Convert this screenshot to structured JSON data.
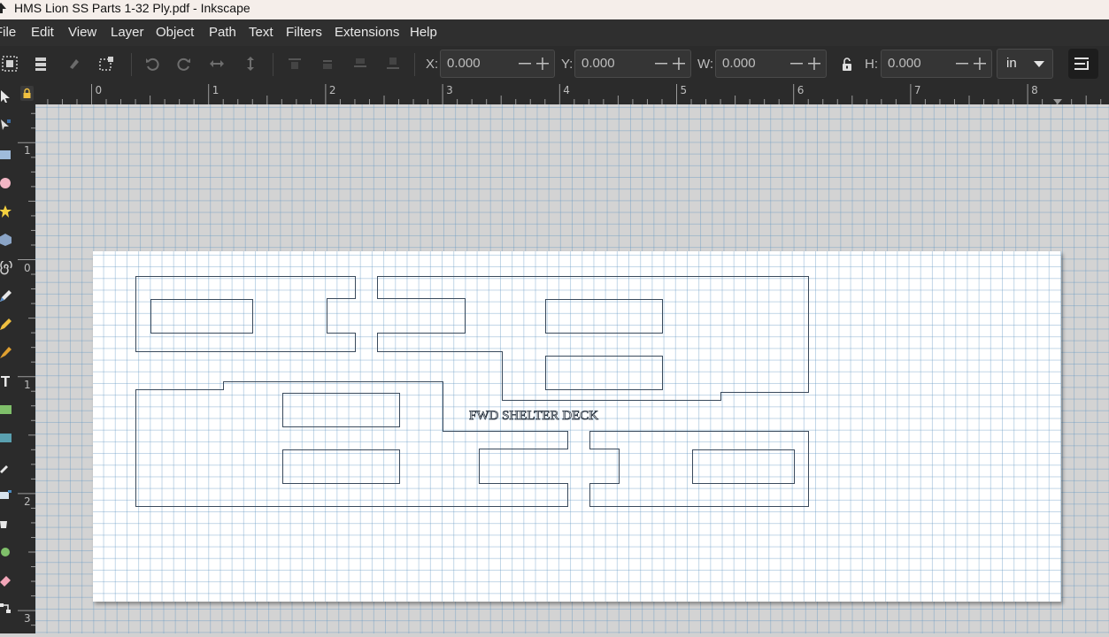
{
  "window": {
    "title": "HMS Lion SS Parts 1-32 Ply.pdf - Inkscape"
  },
  "menu": {
    "items": [
      "File",
      "Edit",
      "View",
      "Layer",
      "Object",
      "Path",
      "Text",
      "Filters",
      "Extensions",
      "Help"
    ]
  },
  "toolbar": {
    "x_label": "X:",
    "x_value": "0.000",
    "y_label": "Y:",
    "y_value": "0.000",
    "w_label": "W:",
    "w_value": "0.000",
    "h_label": "H:",
    "h_value": "0.000",
    "unit": "in",
    "icons": [
      "select-all-icon",
      "select-all-layers-icon",
      "deselect-icon",
      "select-same-icon",
      "rotate-ccw-icon",
      "rotate-cw-icon",
      "flip-horizontal-icon",
      "flip-vertical-icon",
      "raise-to-top-icon",
      "raise-icon",
      "lower-icon",
      "lower-to-bottom-icon",
      "lock-proportions-icon",
      "snap-controls-icon"
    ]
  },
  "rulers": {
    "horizontal_labels": [
      "0",
      "1",
      "2",
      "3",
      "4",
      "5",
      "6",
      "7",
      "8"
    ],
    "vertical_labels": [
      "1",
      "0",
      "1",
      "2",
      "3"
    ]
  },
  "tools": [
    "selector-icon",
    "node-icon",
    "rectangle-icon",
    "circle-icon",
    "star-icon",
    "3d-box-icon",
    "spiral-icon",
    "pencil-icon",
    "pen-icon",
    "calligraphy-icon",
    "text-icon",
    "gradient-icon",
    "mesh-icon",
    "dropper-icon",
    "spray-icon",
    "paint-bucket-icon",
    "tweak-icon",
    "eraser-icon",
    "connector-icon"
  ],
  "document": {
    "label": "FWD SHELTER DECK"
  },
  "colors": {
    "menubar": "#2f2f2f",
    "toolbar": "#2b2b2b",
    "canvas": "#d3d3d3",
    "page": "#ffffff",
    "grid": "#5c93c0",
    "outline": "#3a4a5c"
  }
}
